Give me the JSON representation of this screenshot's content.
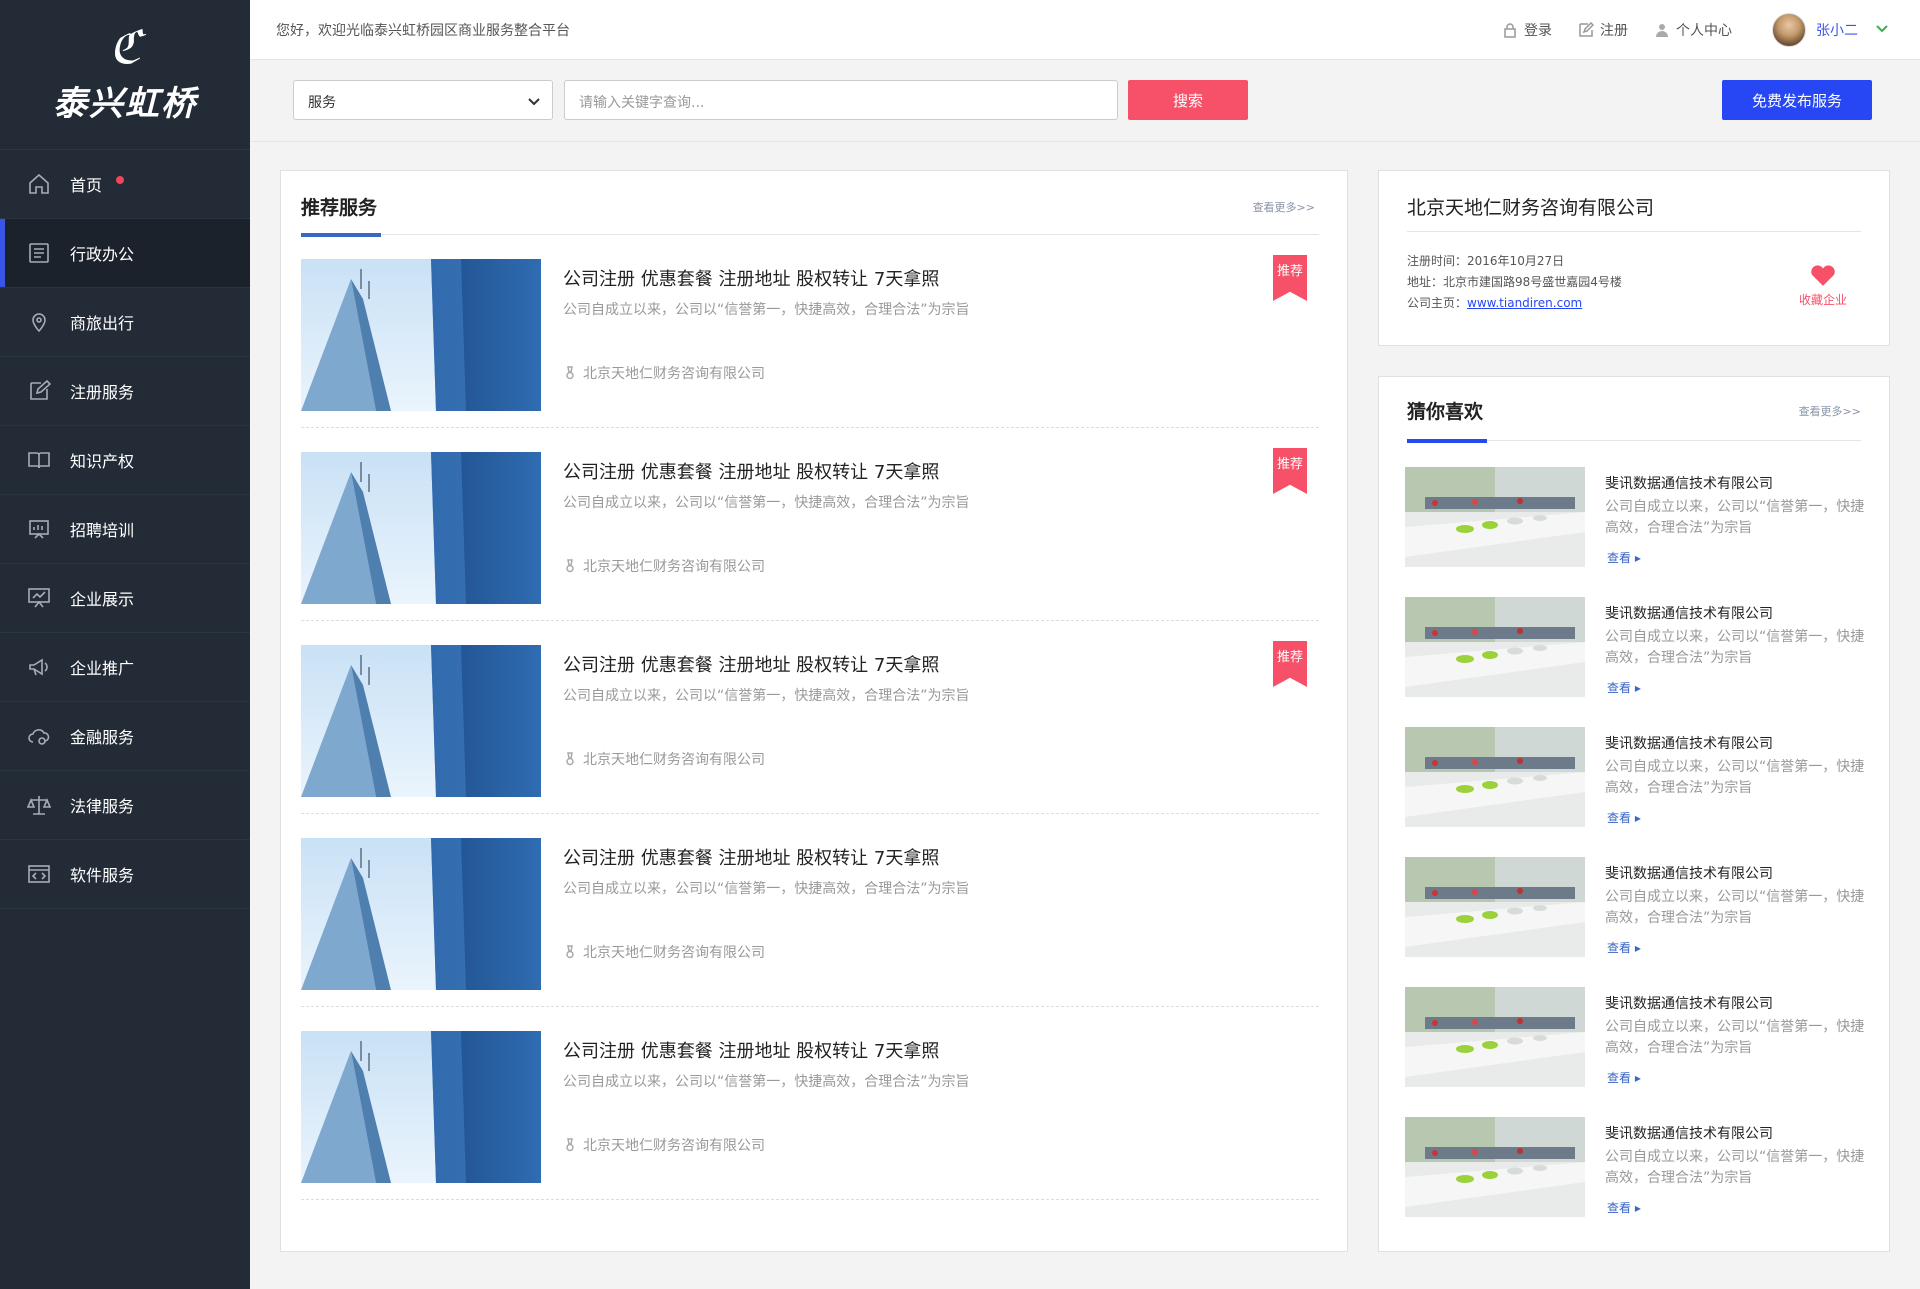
{
  "brand": {
    "mark": "ℭ",
    "name": "泰兴虹桥"
  },
  "topbar": {
    "welcome": "您好，欢迎光临泰兴虹桥园区商业服务整合平台",
    "login": "登录",
    "register": "注册",
    "profile": "个人中心",
    "user_name": "张小二"
  },
  "sidebar": {
    "items": [
      {
        "label": "首页",
        "icon": "home-icon"
      },
      {
        "label": "行政办公",
        "icon": "document-icon"
      },
      {
        "label": "商旅出行",
        "icon": "location-pin-icon"
      },
      {
        "label": "注册服务",
        "icon": "edit-icon"
      },
      {
        "label": "知识产权",
        "icon": "book-icon"
      },
      {
        "label": "招聘培训",
        "icon": "presentation-icon"
      },
      {
        "label": "企业展示",
        "icon": "board-icon"
      },
      {
        "label": "企业推广",
        "icon": "megaphone-icon"
      },
      {
        "label": "金融服务",
        "icon": "cloud-coin-icon"
      },
      {
        "label": "法律服务",
        "icon": "scales-icon"
      },
      {
        "label": "软件服务",
        "icon": "code-icon"
      }
    ],
    "active_index": 1
  },
  "search": {
    "category": "服务",
    "placeholder": "请输入关键字查询...",
    "button": "搜索",
    "publish": "免费发布服务"
  },
  "recommended": {
    "title": "推荐服务",
    "more": "查看更多>>",
    "badge": "推荐",
    "items": [
      {
        "title": "公司注册 优惠套餐 注册地址 股权转让 7天拿照",
        "desc": "公司自成立以来，公司以“信誉第一，快捷高效，合理合法”为宗旨",
        "company": "北京天地仁财务咨询有限公司",
        "badge": true
      },
      {
        "title": "公司注册 优惠套餐 注册地址 股权转让 7天拿照",
        "desc": "公司自成立以来，公司以“信誉第一，快捷高效，合理合法”为宗旨",
        "company": "北京天地仁财务咨询有限公司",
        "badge": true
      },
      {
        "title": "公司注册 优惠套餐 注册地址 股权转让 7天拿照",
        "desc": "公司自成立以来，公司以“信誉第一，快捷高效，合理合法”为宗旨",
        "company": "北京天地仁财务咨询有限公司",
        "badge": true
      },
      {
        "title": "公司注册 优惠套餐 注册地址 股权转让 7天拿照",
        "desc": "公司自成立以来，公司以“信誉第一，快捷高效，合理合法”为宗旨",
        "company": "北京天地仁财务咨询有限公司",
        "badge": false
      },
      {
        "title": "公司注册 优惠套餐 注册地址 股权转让 7天拿照",
        "desc": "公司自成立以来，公司以“信誉第一，快捷高效，合理合法”为宗旨",
        "company": "北京天地仁财务咨询有限公司",
        "badge": false
      }
    ]
  },
  "company": {
    "name": "北京天地仁财务咨询有限公司",
    "reg_label": "注册时间：",
    "reg_date": "2016年10月27日",
    "addr_label": "地址：",
    "address": "北京市建国路98号盛世嘉园4号楼",
    "home_label": "公司主页：",
    "homepage": "www.tiandiren.com",
    "favorite": "收藏企业"
  },
  "guess": {
    "title": "猜你喜欢",
    "more": "查看更多>>",
    "view": "查看 ▸",
    "items": [
      {
        "title": "斐讯数据通信技术有限公司",
        "desc": "公司自成立以来，公司以“信誉第一，快捷高效，合理合法”为宗旨"
      },
      {
        "title": "斐讯数据通信技术有限公司",
        "desc": "公司自成立以来，公司以“信誉第一，快捷高效，合理合法”为宗旨"
      },
      {
        "title": "斐讯数据通信技术有限公司",
        "desc": "公司自成立以来，公司以“信誉第一，快捷高效，合理合法”为宗旨"
      },
      {
        "title": "斐讯数据通信技术有限公司",
        "desc": "公司自成立以来，公司以“信誉第一，快捷高效，合理合法”为宗旨"
      },
      {
        "title": "斐讯数据通信技术有限公司",
        "desc": "公司自成立以来，公司以“信誉第一，快捷高效，合理合法”为宗旨"
      },
      {
        "title": "斐讯数据通信技术有限公司",
        "desc": "公司自成立以来，公司以“信誉第一，快捷高效，合理合法”为宗旨"
      }
    ]
  },
  "colors": {
    "sidebar": "#222b36",
    "accent_blue": "#2747f5",
    "accent_red": "#f7516a"
  }
}
